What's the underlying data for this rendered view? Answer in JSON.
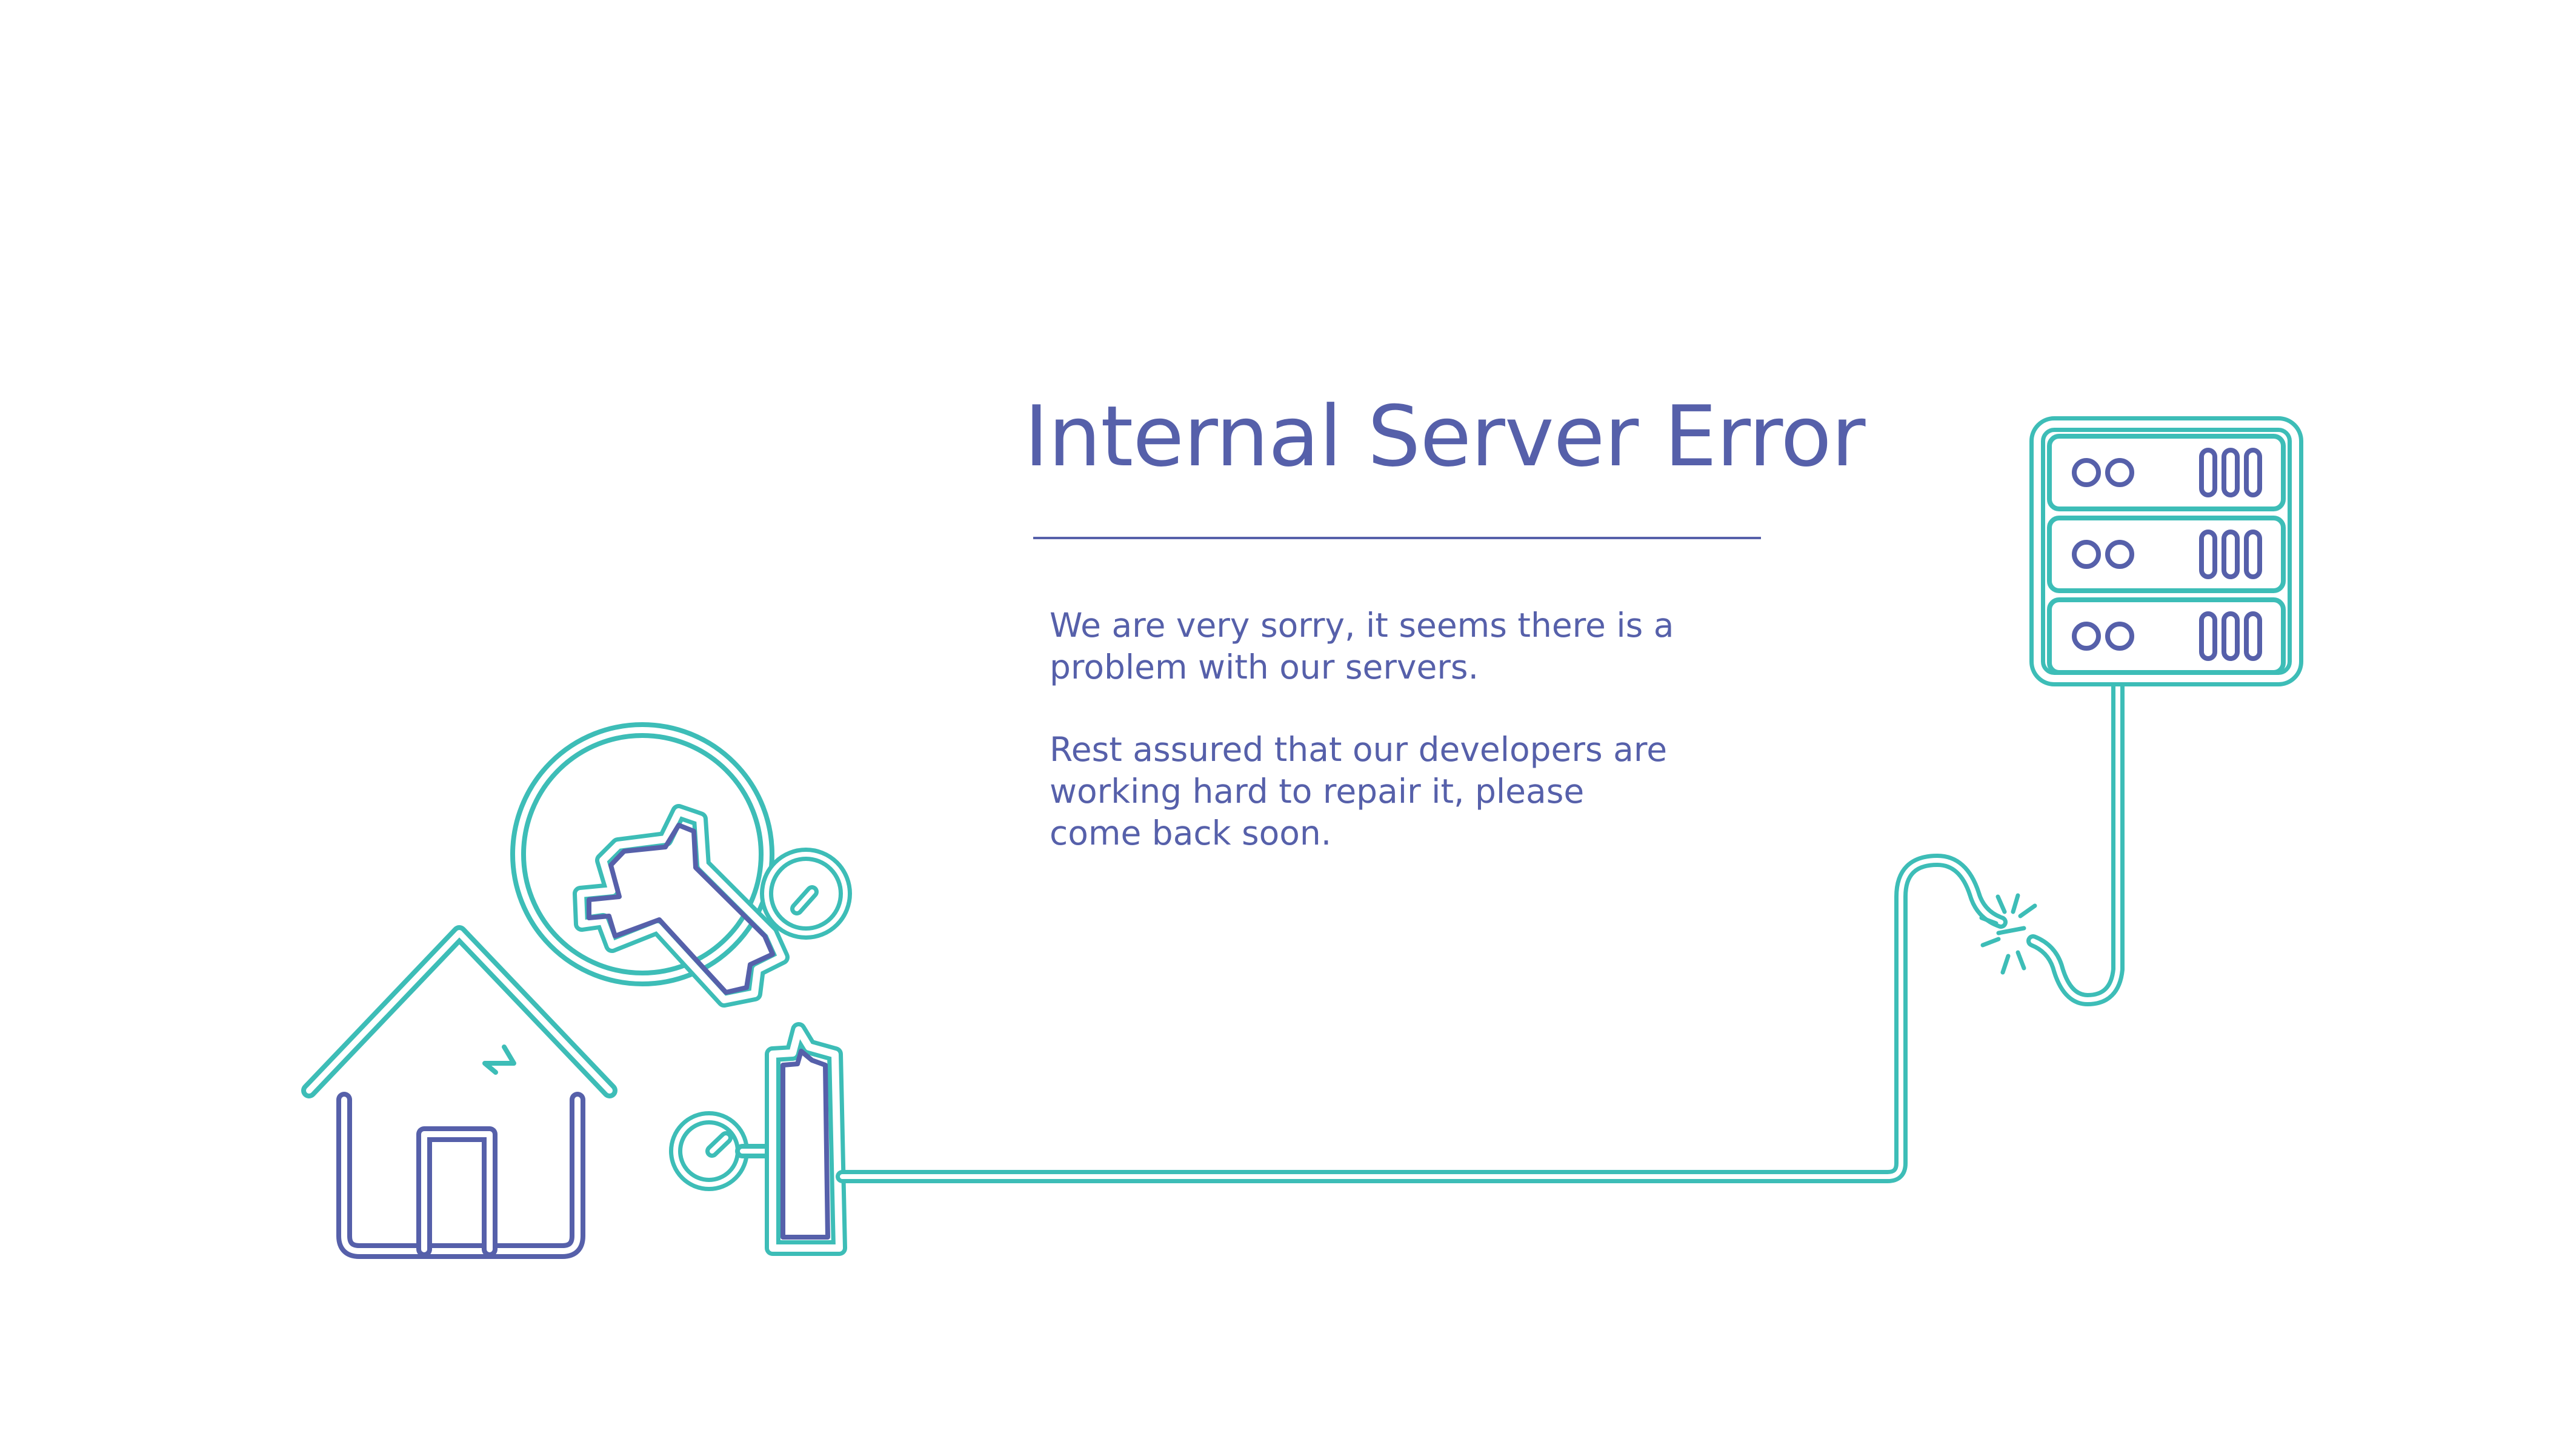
{
  "page": {
    "title": "Internal Server Error",
    "message_lines": [
      "We are very sorry, it seems there is a",
      "problem with our servers.",
      "Rest assured that our developers are",
      "working hard to repair it, please",
      "come back soon."
    ]
  },
  "illustration": {
    "icons": [
      "house-icon",
      "wrench-icon",
      "plug-icon",
      "server-rack-icon",
      "cable-icon",
      "disconnect-spark-icon"
    ]
  },
  "colors": {
    "background": "#FFFFFF",
    "primary_text": "#5660AA",
    "accent_teal": "#3DBDB7",
    "indigo_line": "#5660AA"
  }
}
